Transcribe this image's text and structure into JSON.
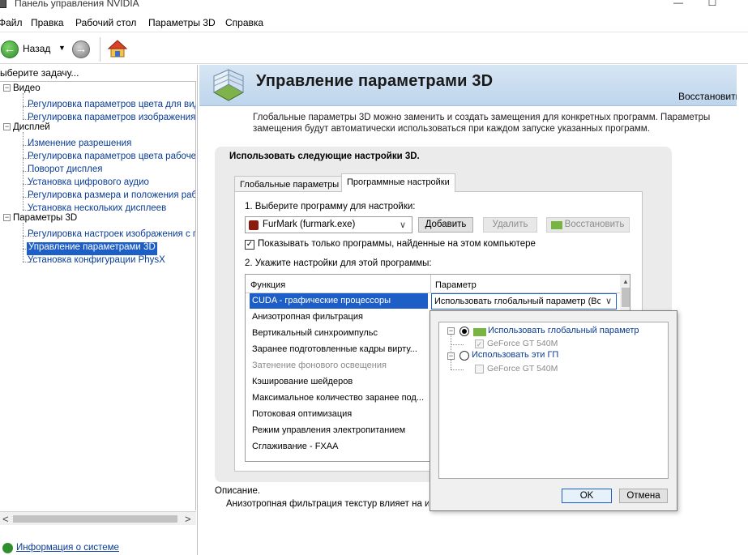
{
  "window": {
    "title": "Панель управления NVIDIA",
    "minimize_glyph": "—",
    "maximize_glyph": "☐"
  },
  "menu": [
    "Файл",
    "Правка",
    "Рабочий стол",
    "Параметры 3D",
    "Справка"
  ],
  "toolbar": {
    "back_label": "Назад",
    "back_dropdown_glyph": "▼",
    "back_arrow_glyph": "←",
    "forward_arrow_glyph": "→"
  },
  "sidebar": {
    "task_header": "ыберите задачу...",
    "groups": [
      {
        "label": "Видео",
        "toggle": "−",
        "items": [
          "Регулировка параметров цвета для вид",
          "Регулировка параметров изображения д"
        ]
      },
      {
        "label": "Дисплей",
        "toggle": "−",
        "items": [
          "Изменение разрешения",
          "Регулировка параметров цвета рабочег",
          "Поворот дисплея",
          "Установка цифрового аудио",
          "Регулировка размера и положения рабо",
          "Установка нескольких дисплеев"
        ]
      },
      {
        "label": "Параметры 3D",
        "toggle": "−",
        "items": [
          "Регулировка настроек изображения с пр",
          "Управление параметрами 3D",
          "Установка конфигурации PhysX"
        ]
      }
    ],
    "selected_item": "Управление параметрами 3D",
    "scroll_left_glyph": "<",
    "scroll_right_glyph": ">",
    "system_info_link": "Информация о системе"
  },
  "main": {
    "page_title": "Управление параметрами 3D",
    "restore_link": "Восстановить",
    "description": "Глобальные параметры 3D можно заменить и создать замещения для конкретных программ. Параметры замещения будут автоматически использоваться при каждом запуске указанных программ.",
    "group_title": "Использовать следующие настройки 3D.",
    "tabs": [
      {
        "label": "Глобальные параметры",
        "active": false
      },
      {
        "label": "Программные настройки",
        "active": true
      }
    ],
    "step1_label": "1. Выберите программу для настройки:",
    "program_selected": "FurMark (furmark.exe)",
    "add_button": "Добавить",
    "remove_button": "Удалить",
    "restore_button": "Восстановить",
    "show_only_checked": true,
    "check_glyph": "✓",
    "chevron_glyph": "∨",
    "show_only_label": "Показывать только программы, найденные на этом компьютере",
    "step2_label": "2. Укажите настройки для этой программы:",
    "table": {
      "col_function": "Функция",
      "col_parameter": "Параметр",
      "rows": [
        {
          "label": "CUDA - графические процессоры",
          "state": "selected"
        },
        {
          "label": "Анизотропная фильтрация",
          "state": "normal"
        },
        {
          "label": "Вертикальный синхроимпульс",
          "state": "normal"
        },
        {
          "label": "Заранее подготовленные кадры вирту...",
          "state": "normal"
        },
        {
          "label": "Затенение фонового освещения",
          "state": "disabled"
        },
        {
          "label": "Кэширование шейдеров",
          "state": "normal"
        },
        {
          "label": "Максимальное количество заранее под...",
          "state": "normal"
        },
        {
          "label": "Потоковая оптимизация",
          "state": "normal"
        },
        {
          "label": "Режим управления электропитанием",
          "state": "normal"
        },
        {
          "label": "Сглаживание - FXAA",
          "state": "normal"
        }
      ],
      "selected_param_value": "Использовать глобальный параметр (Все)",
      "scroll_up_glyph": "▲"
    },
    "description_label": "Описание.",
    "description_text": "Анизотропная фильтрация текстур влияет на их"
  },
  "gpu_popup": {
    "option_global": "Использовать глобальный параметр",
    "option_global_gpu": "GeForce GT 540M",
    "option_custom": "Использовать эти ГП",
    "option_custom_gpu": "GeForce GT 540M",
    "toggle_glyph": "−",
    "selected_option": "global",
    "ok_button": "OK",
    "cancel_button": "Отмена"
  },
  "colors": {
    "accent": "#1e5fc7",
    "link": "#0a3c96",
    "nvidia_green": "#78b441",
    "header_band": "#c9dcef"
  }
}
